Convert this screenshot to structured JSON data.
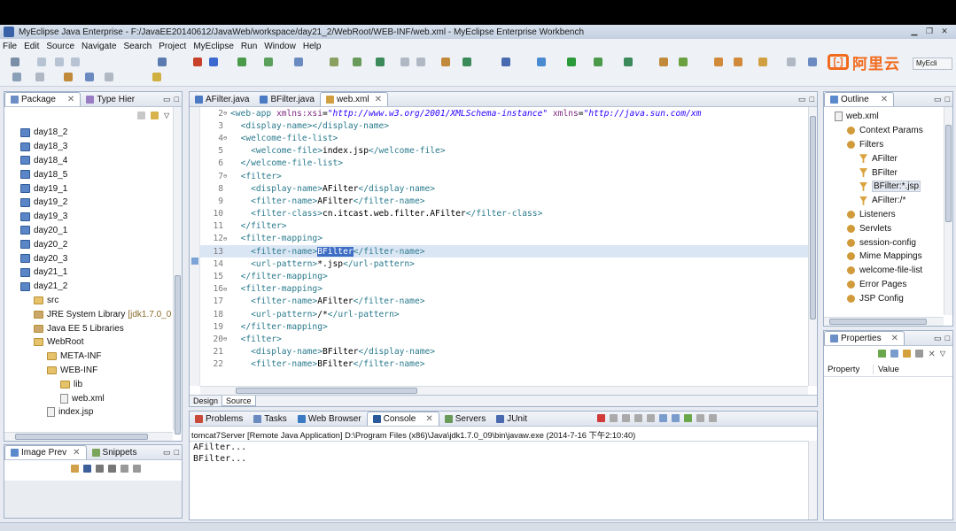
{
  "window": {
    "title": "MyEclipse Java Enterprise - F:/JavaEE20140612/JavaWeb/workspace/day21_2/WebRoot/WEB-INF/web.xml - MyEclipse Enterprise Workbench"
  },
  "menu": [
    "File",
    "Edit",
    "Source",
    "Navigate",
    "Search",
    "Project",
    "MyEclipse",
    "Run",
    "Window",
    "Help"
  ],
  "brand": {
    "text": "阿里云",
    "logo_text": "[-]"
  },
  "perspective": {
    "label": "MyEcli"
  },
  "package": {
    "tabs": [
      "Package",
      "Type Hier"
    ],
    "items": [
      {
        "label": "day18_2",
        "kind": "project",
        "indent": 1
      },
      {
        "label": "day18_3",
        "kind": "project",
        "indent": 1
      },
      {
        "label": "day18_4",
        "kind": "project",
        "indent": 1
      },
      {
        "label": "day18_5",
        "kind": "project",
        "indent": 1
      },
      {
        "label": "day19_1",
        "kind": "project",
        "indent": 1
      },
      {
        "label": "day19_2",
        "kind": "project",
        "indent": 1
      },
      {
        "label": "day19_3",
        "kind": "project",
        "indent": 1
      },
      {
        "label": "day20_1",
        "kind": "project",
        "indent": 1
      },
      {
        "label": "day20_2",
        "kind": "project",
        "indent": 1
      },
      {
        "label": "day20_3",
        "kind": "project",
        "indent": 1
      },
      {
        "label": "day21_1",
        "kind": "project",
        "indent": 1
      },
      {
        "label": "day21_2",
        "kind": "project",
        "indent": 1
      },
      {
        "label": "src",
        "kind": "folder",
        "indent": 2
      },
      {
        "label": "JRE System Library",
        "suffix": "[jdk1.7.0_0",
        "kind": "lib",
        "indent": 2
      },
      {
        "label": "Java EE 5 Libraries",
        "kind": "lib",
        "indent": 2
      },
      {
        "label": "WebRoot",
        "kind": "folder",
        "indent": 2
      },
      {
        "label": "META-INF",
        "kind": "folder",
        "indent": 3
      },
      {
        "label": "WEB-INF",
        "kind": "folder",
        "indent": 3
      },
      {
        "label": "lib",
        "kind": "folder",
        "indent": 4
      },
      {
        "label": "web.xml",
        "kind": "file",
        "indent": 4
      },
      {
        "label": "index.jsp",
        "kind": "file",
        "indent": 3
      }
    ]
  },
  "imageprev": {
    "tabs": [
      "Image Prev",
      "Snippets"
    ]
  },
  "editor": {
    "tabs": [
      "AFilter.java",
      "BFilter.java",
      "web.xml"
    ],
    "bottom_tabs": [
      "Design",
      "Source"
    ],
    "lines": [
      {
        "n": "2",
        "fold": "⊖",
        "segs": [
          [
            "t",
            "<web-app "
          ],
          [
            "a",
            "xmlns:xsi"
          ],
          [
            "x",
            "="
          ],
          [
            "s",
            "\"http://www.w3.org/2001/XMLSchema-instance\""
          ],
          [
            "x",
            " "
          ],
          [
            "a",
            "xmlns"
          ],
          [
            "x",
            "="
          ],
          [
            "s",
            "\"http://java.sun.com/xm"
          ]
        ]
      },
      {
        "n": "3",
        "segs": [
          [
            "x",
            "  "
          ],
          [
            "t",
            "<display-name></display-name>"
          ]
        ]
      },
      {
        "n": "4",
        "fold": "⊖",
        "segs": [
          [
            "x",
            "  "
          ],
          [
            "t",
            "<welcome-file-list>"
          ]
        ]
      },
      {
        "n": "5",
        "segs": [
          [
            "x",
            "    "
          ],
          [
            "t",
            "<welcome-file>"
          ],
          [
            "x",
            "index.jsp"
          ],
          [
            "t",
            "</welcome-file>"
          ]
        ]
      },
      {
        "n": "6",
        "segs": [
          [
            "x",
            "  "
          ],
          [
            "t",
            "</welcome-file-list>"
          ]
        ]
      },
      {
        "n": "7",
        "fold": "⊖",
        "segs": [
          [
            "x",
            "  "
          ],
          [
            "t",
            "<filter>"
          ]
        ]
      },
      {
        "n": "8",
        "segs": [
          [
            "x",
            "    "
          ],
          [
            "t",
            "<display-name>"
          ],
          [
            "x",
            "AFilter"
          ],
          [
            "t",
            "</display-name>"
          ]
        ]
      },
      {
        "n": "9",
        "segs": [
          [
            "x",
            "    "
          ],
          [
            "t",
            "<filter-name>"
          ],
          [
            "x",
            "AFilter"
          ],
          [
            "t",
            "</filter-name>"
          ]
        ]
      },
      {
        "n": "10",
        "segs": [
          [
            "x",
            "    "
          ],
          [
            "t",
            "<filter-class>"
          ],
          [
            "x",
            "cn.itcast.web.filter.AFilter"
          ],
          [
            "t",
            "</filter-class>"
          ]
        ]
      },
      {
        "n": "11",
        "segs": [
          [
            "x",
            "  "
          ],
          [
            "t",
            "</filter>"
          ]
        ]
      },
      {
        "n": "12",
        "fold": "⊖",
        "segs": [
          [
            "x",
            "  "
          ],
          [
            "t",
            "<filter-mapping>"
          ]
        ]
      },
      {
        "n": "13",
        "cur": true,
        "segs": [
          [
            "x",
            "    "
          ],
          [
            "t",
            "<filter-name>"
          ],
          [
            "sel",
            "BFilter"
          ],
          [
            "t",
            "</filter-name>"
          ]
        ]
      },
      {
        "n": "14",
        "segs": [
          [
            "x",
            "    "
          ],
          [
            "t",
            "<url-pattern>"
          ],
          [
            "x",
            "*.jsp"
          ],
          [
            "t",
            "</url-pattern>"
          ]
        ]
      },
      {
        "n": "15",
        "segs": [
          [
            "x",
            "  "
          ],
          [
            "t",
            "</filter-mapping>"
          ]
        ]
      },
      {
        "n": "16",
        "fold": "⊖",
        "segs": [
          [
            "x",
            "  "
          ],
          [
            "t",
            "<filter-mapping>"
          ]
        ]
      },
      {
        "n": "17",
        "segs": [
          [
            "x",
            "    "
          ],
          [
            "t",
            "<filter-name>"
          ],
          [
            "x",
            "AFilter"
          ],
          [
            "t",
            "</filter-name>"
          ]
        ]
      },
      {
        "n": "18",
        "segs": [
          [
            "x",
            "    "
          ],
          [
            "t",
            "<url-pattern>"
          ],
          [
            "x",
            "/*"
          ],
          [
            "t",
            "</url-pattern>"
          ]
        ]
      },
      {
        "n": "19",
        "segs": [
          [
            "x",
            "  "
          ],
          [
            "t",
            "</filter-mapping>"
          ]
        ]
      },
      {
        "n": "20",
        "fold": "⊖",
        "segs": [
          [
            "x",
            "  "
          ],
          [
            "t",
            "<filter>"
          ]
        ]
      },
      {
        "n": "21",
        "segs": [
          [
            "x",
            "    "
          ],
          [
            "t",
            "<display-name>"
          ],
          [
            "x",
            "BFilter"
          ],
          [
            "t",
            "</display-name>"
          ]
        ]
      },
      {
        "n": "22",
        "segs": [
          [
            "x",
            "    "
          ],
          [
            "t",
            "<filter-name>"
          ],
          [
            "x",
            "BFilter"
          ],
          [
            "t",
            "</filter-name>"
          ]
        ]
      }
    ]
  },
  "console": {
    "tabs": [
      "Problems",
      "Tasks",
      "Web Browser",
      "Console",
      "Servers",
      "JUnit"
    ],
    "header": "tomcat7Server [Remote Java Application] D:\\Program Files (x86)\\Java\\jdk1.7.0_09\\bin\\javaw.exe (2014-7-16 下午2:10:40)",
    "lines": [
      "AFilter...",
      "BFilter..."
    ]
  },
  "outline": {
    "tab": "Outline",
    "items": [
      {
        "label": "web.xml",
        "kind": "file",
        "indent": 0
      },
      {
        "label": "Context Params",
        "kind": "gear",
        "indent": 1
      },
      {
        "label": "Filters",
        "kind": "gear",
        "indent": 1
      },
      {
        "label": "AFilter",
        "kind": "filter",
        "indent": 2
      },
      {
        "label": "BFilter",
        "kind": "filter",
        "indent": 2
      },
      {
        "label": "BFilter:*.jsp",
        "kind": "filter",
        "indent": 2,
        "selected": true
      },
      {
        "label": "AFilter:/*",
        "kind": "filter",
        "indent": 2
      },
      {
        "label": "Listeners",
        "kind": "gear",
        "indent": 1
      },
      {
        "label": "Servlets",
        "kind": "gear",
        "indent": 1
      },
      {
        "label": "session-config",
        "kind": "gear",
        "indent": 1
      },
      {
        "label": "Mime Mappings",
        "kind": "gear",
        "indent": 1
      },
      {
        "label": "welcome-file-list",
        "kind": "gear",
        "indent": 1
      },
      {
        "label": "Error Pages",
        "kind": "gear",
        "indent": 1
      },
      {
        "label": "JSP Config",
        "kind": "gear",
        "indent": 1
      }
    ]
  },
  "properties": {
    "tab": "Properties",
    "col1": "Property",
    "col2": "Value"
  },
  "colors": {
    "selection": "#3d6dc4",
    "tag": "#2a7a8c",
    "string": "#2a00ff",
    "brand": "#f26b1d"
  }
}
